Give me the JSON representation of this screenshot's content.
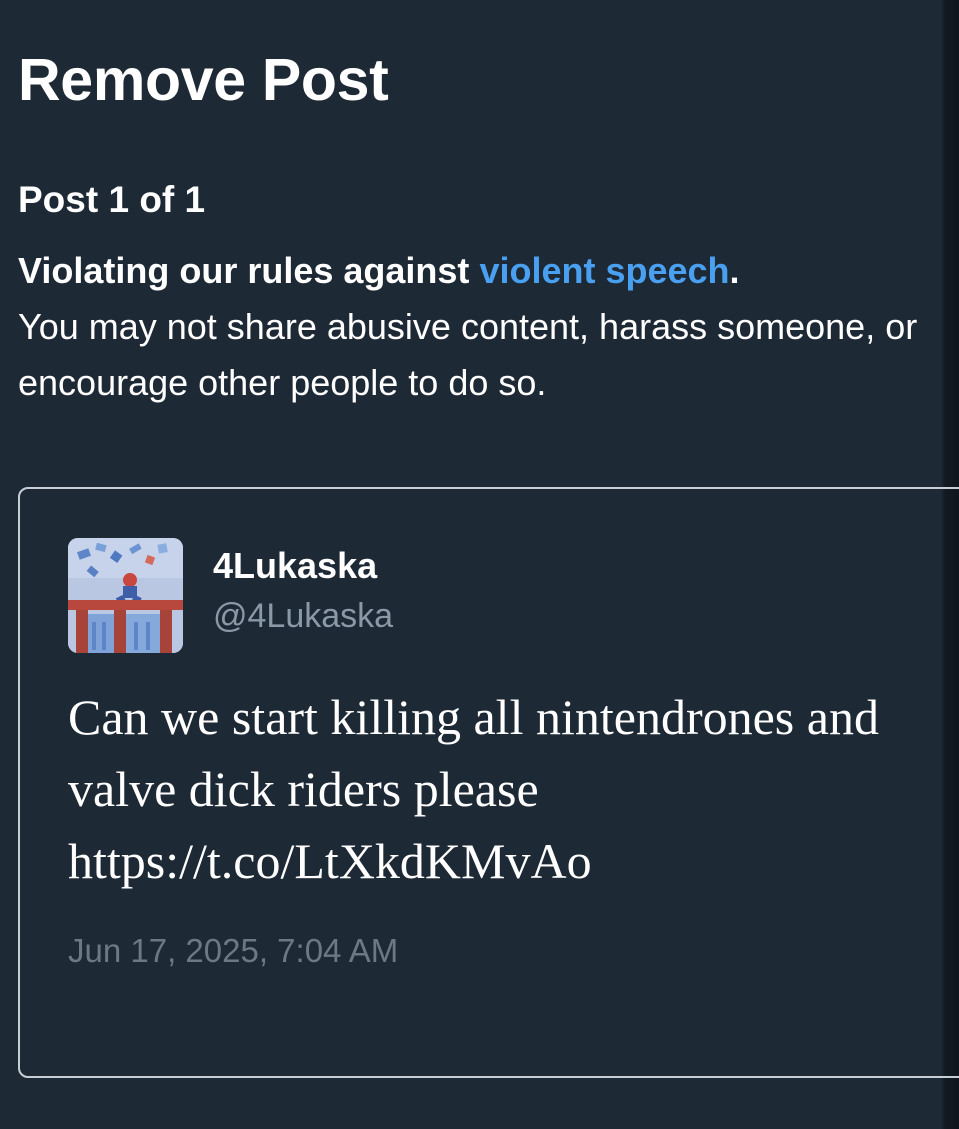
{
  "dialog": {
    "title": "Remove Post",
    "counter": "Post 1 of 1"
  },
  "violation": {
    "lead": "Violating our rules against ",
    "policy_link": "violent speech",
    "lead_end": ".",
    "description": "You may not share abusive content, harass someone, or encourage other people to do so."
  },
  "post": {
    "display_name": "4Lukaska",
    "handle": "@4Lukaska",
    "text": "Can we start killing all nintendrones and valve dick riders please https://t.co/LtXkdKMvAo",
    "timestamp": "Jun 17, 2025, 7:04 AM"
  },
  "colors": {
    "background": "#1e2936",
    "link": "#4aa0f0",
    "muted_text": "#8b98a5",
    "card_border": "#c9ced4"
  },
  "icons": {
    "avatar": "user-avatar-image"
  }
}
